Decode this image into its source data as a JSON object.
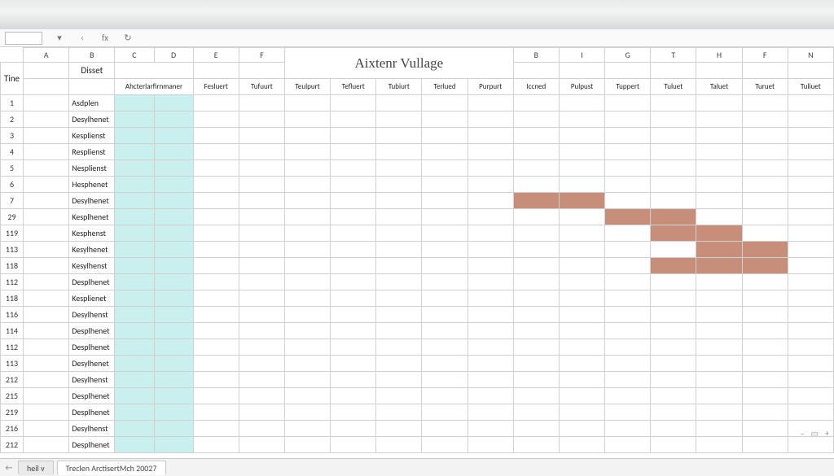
{
  "formula_bar": {
    "name_box": "",
    "back": "‹",
    "fx": "fx",
    "redo": "↻"
  },
  "columns_letters": [
    "A",
    "B",
    "C",
    "D",
    "E",
    "F",
    "",
    "",
    "",
    "",
    "",
    "B",
    "I",
    "G",
    "T",
    "H",
    "F",
    "N"
  ],
  "title": "Aixtenr Vullage",
  "row_header_label": "Tine",
  "group_header_b": "Disset",
  "sub_headers": [
    "",
    "",
    "Ahcterlarfirnmaner",
    "",
    "Fesluert",
    "Tufuurt",
    "Teulpurt",
    "Tefluert",
    "Tubiurt",
    "Terlued",
    "Purpurt",
    "Iccned",
    "Pulpust",
    "Tuppert",
    "Tuluet",
    "Taluet",
    "Turuet",
    "Tuliuet"
  ],
  "rows": [
    {
      "n": "1",
      "label": "Asdplen",
      "bars": []
    },
    {
      "n": "2",
      "label": "Desylhenet",
      "bars": []
    },
    {
      "n": "3",
      "label": "Kesplienst",
      "bars": []
    },
    {
      "n": "4",
      "label": "Resplienst",
      "bars": []
    },
    {
      "n": "5",
      "label": "Nesplienst",
      "bars": []
    },
    {
      "n": "6",
      "label": "Hesphenet",
      "bars": []
    },
    {
      "n": "7",
      "label": "Desylhenet",
      "bars": [
        12,
        13
      ]
    },
    {
      "n": "29",
      "label": "Kesplhenet",
      "bars": [
        14,
        15
      ]
    },
    {
      "n": "119",
      "label": "Kesphenst",
      "bars": [
        15,
        16
      ]
    },
    {
      "n": "113",
      "label": "Kesylhenet",
      "bars": [
        16,
        17
      ]
    },
    {
      "n": "118",
      "label": "Kesylhenst",
      "bars": [
        15,
        16,
        17
      ]
    },
    {
      "n": "112",
      "label": "Desplhenet",
      "bars": []
    },
    {
      "n": "118",
      "label": "Kesplienet",
      "bars": []
    },
    {
      "n": "116",
      "label": "Desylhenst",
      "bars": []
    },
    {
      "n": "114",
      "label": "Desplhenet",
      "bars": []
    },
    {
      "n": "112",
      "label": "Desplhenet",
      "bars": []
    },
    {
      "n": "113",
      "label": "Desylhenet",
      "bars": []
    },
    {
      "n": "212",
      "label": "Desylhenst",
      "bars": []
    },
    {
      "n": "215",
      "label": "Desplhenet",
      "bars": []
    },
    {
      "n": "219",
      "label": "Desplhenet",
      "bars": []
    },
    {
      "n": "216",
      "label": "Desylhenst",
      "bars": []
    },
    {
      "n": "212",
      "label": "Desplhenet",
      "bars": []
    }
  ],
  "tabs": {
    "nav_back": "←",
    "tab1": "heil v",
    "tab2": "Treclen ArctisertMch 20027"
  },
  "zoom": {
    "dash": "–",
    "plus": "+"
  }
}
